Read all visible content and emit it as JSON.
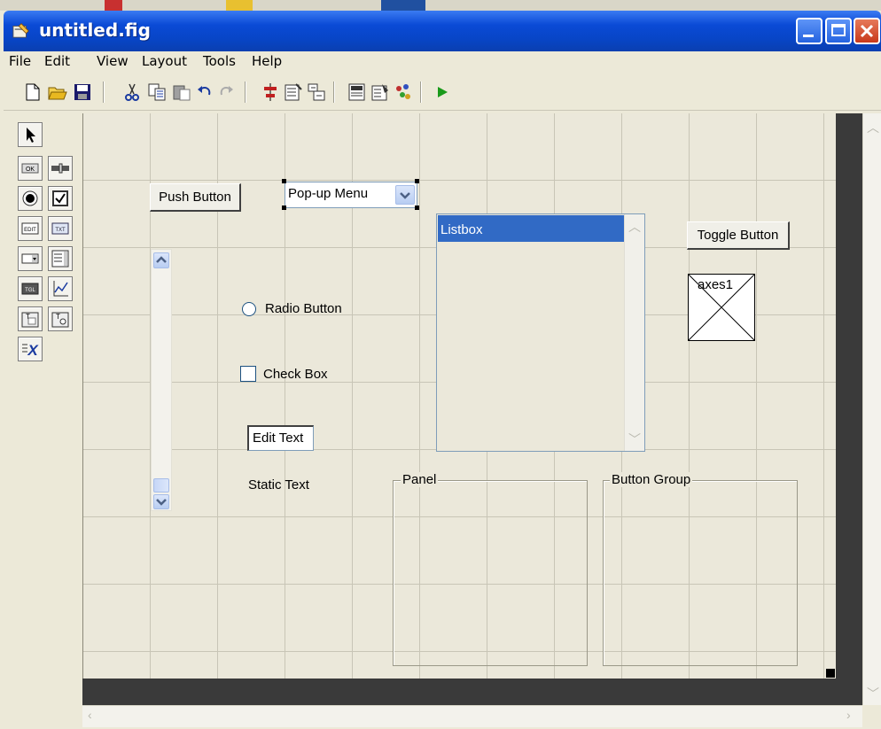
{
  "window": {
    "title": "untitled.fig"
  },
  "menu": [
    "File",
    "Edit",
    "View",
    "Layout",
    "Tools",
    "Help"
  ],
  "toolbar": {
    "icons": [
      "new-icon",
      "open-icon",
      "save-icon",
      "cut-icon",
      "copy-icon",
      "paste-icon",
      "undo-icon",
      "redo-icon",
      "align-icon",
      "menu-editor-icon",
      "tab-order-icon",
      "mfile-editor-icon",
      "property-inspector-icon",
      "object-browser-icon",
      "run-icon"
    ]
  },
  "palette": {
    "tools": [
      {
        "name": "select-tool-icon",
        "label": ""
      },
      {
        "name": "push-button-tool-icon",
        "label": "OK"
      },
      {
        "name": "slider-tool-icon",
        "label": ""
      },
      {
        "name": "radio-button-tool-icon",
        "label": ""
      },
      {
        "name": "check-box-tool-icon",
        "label": ""
      },
      {
        "name": "edit-text-tool-icon",
        "label": "EDIT"
      },
      {
        "name": "static-text-tool-icon",
        "label": "TXT"
      },
      {
        "name": "popup-menu-tool-icon",
        "label": ""
      },
      {
        "name": "listbox-tool-icon",
        "label": ""
      },
      {
        "name": "toggle-button-tool-icon",
        "label": "TGL"
      },
      {
        "name": "axes-tool-icon",
        "label": ""
      },
      {
        "name": "panel-tool-icon",
        "label": "T"
      },
      {
        "name": "button-group-tool-icon",
        "label": "T"
      },
      {
        "name": "activex-control-tool-icon",
        "label": "X"
      }
    ]
  },
  "components": {
    "push_button": "Push Button",
    "popup_menu": "Pop-up Menu",
    "listbox": "Listbox",
    "toggle_button": "Toggle Button",
    "axes": "axes1",
    "radio_button": "Radio Button",
    "check_box": "Check Box",
    "edit_text": "Edit Text",
    "static_text": "Static Text",
    "panel": "Panel",
    "button_group": "Button Group"
  },
  "colors": {
    "titlebar": "#0a4ad6",
    "selection": "#316ac5",
    "canvas": "#ebe8da"
  }
}
